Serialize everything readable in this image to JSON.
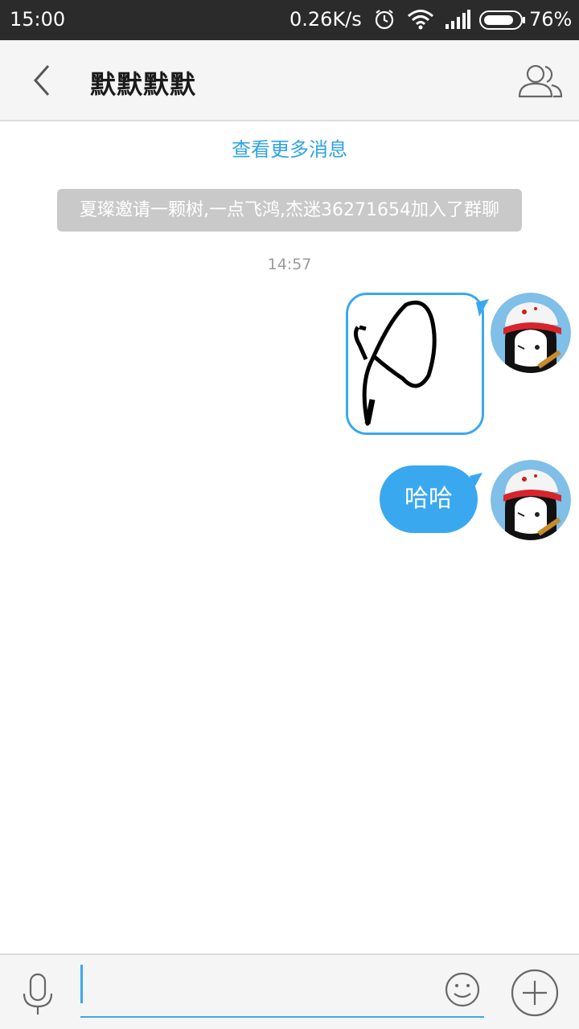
{
  "statusbar": {
    "time": "15:00",
    "speed": "0.26K/s",
    "battery": "76%",
    "icons": [
      "alarm-icon",
      "wifi-icon",
      "signal-icon",
      "battery-icon"
    ]
  },
  "header": {
    "back_icon": "chevron-left-icon",
    "title": "默默默默",
    "group_icon": "group-members-icon"
  },
  "chat": {
    "more_messages": "查看更多消息",
    "system_notice": "夏璨邀请一颗树,一点飞鸿,杰迷36271654加入了群聊",
    "timestamp": "14:57",
    "messages": [
      {
        "type": "image",
        "content": "handwritten-drawing",
        "sender": "self"
      },
      {
        "type": "text",
        "content": "哈哈",
        "sender": "self"
      }
    ]
  },
  "inputbar": {
    "mic_icon": "microphone-icon",
    "input_value": "",
    "emoji_icon": "smiley-icon",
    "plus_icon": "plus-circle-icon"
  },
  "colors": {
    "accent": "#3aa8ef",
    "link": "#2fa3e6",
    "notice_bg": "#c9c9c9",
    "statusbar_bg": "#2b2b2b"
  }
}
